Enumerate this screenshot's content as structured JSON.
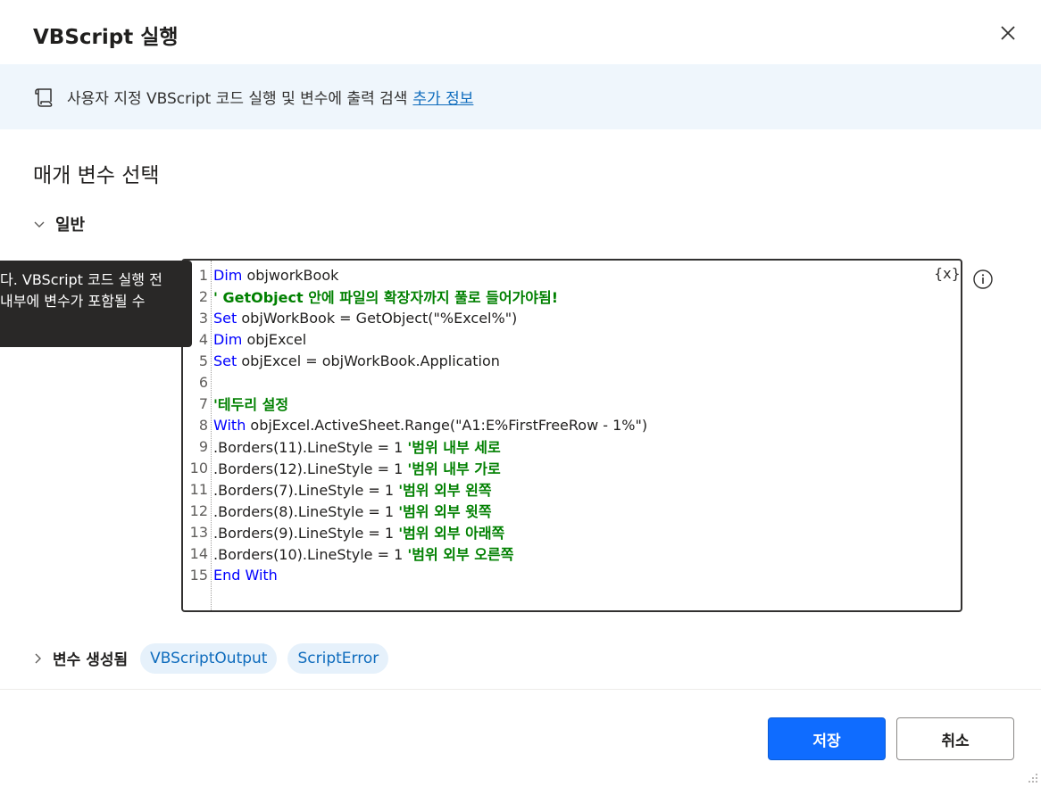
{
  "dialog": {
    "title": "VBScript 실행",
    "close_icon": "close-icon"
  },
  "info": {
    "icon": "script-icon",
    "description": "사용자 지정 VBScript 코드 실행 및 변수에 출력 검색",
    "link_label": "추가 정보"
  },
  "section": {
    "title": "매개 변수 선택",
    "group_label": "일반"
  },
  "tooltip": {
    "line1": "다. VBScript 코드 실행 전",
    "line2": " 내부에 변수가 포함될 수"
  },
  "editor": {
    "var_button_label": "{x}",
    "lines": [
      {
        "num": "1",
        "parts": [
          {
            "t": "Dim",
            "c": "kw"
          },
          {
            "t": " objworkBook",
            "c": "pl"
          }
        ]
      },
      {
        "num": "2",
        "parts": [
          {
            "t": "' GetObject 안에 파일의 확장자까지 풀로 들어가야됨!",
            "c": "cm"
          }
        ]
      },
      {
        "num": "3",
        "parts": [
          {
            "t": "Set",
            "c": "kw"
          },
          {
            "t": " objWorkBook = GetObject(\"%Excel%\")",
            "c": "pl"
          }
        ]
      },
      {
        "num": "4",
        "parts": [
          {
            "t": "Dim",
            "c": "kw"
          },
          {
            "t": " objExcel",
            "c": "pl"
          }
        ]
      },
      {
        "num": "5",
        "parts": [
          {
            "t": "Set",
            "c": "kw"
          },
          {
            "t": " objExcel = objWorkBook.Application",
            "c": "pl"
          }
        ]
      },
      {
        "num": "6",
        "parts": []
      },
      {
        "num": "7",
        "parts": [
          {
            "t": "'테두리 설정",
            "c": "cm"
          }
        ]
      },
      {
        "num": "8",
        "parts": [
          {
            "t": "With",
            "c": "kw"
          },
          {
            "t": " objExcel.ActiveSheet.Range(\"A1:E%FirstFreeRow - 1%\")",
            "c": "pl"
          }
        ]
      },
      {
        "num": "9",
        "parts": [
          {
            "t": ".Borders(11).LineStyle = 1 ",
            "c": "pl"
          },
          {
            "t": "'범위 내부 세로",
            "c": "cm"
          }
        ]
      },
      {
        "num": "10",
        "parts": [
          {
            "t": ".Borders(12).LineStyle = 1 ",
            "c": "pl"
          },
          {
            "t": "'범위 내부 가로",
            "c": "cm"
          }
        ]
      },
      {
        "num": "11",
        "parts": [
          {
            "t": ".Borders(7).LineStyle = 1 ",
            "c": "pl"
          },
          {
            "t": "'범위 외부 왼쪽",
            "c": "cm"
          }
        ]
      },
      {
        "num": "12",
        "parts": [
          {
            "t": ".Borders(8).LineStyle = 1 ",
            "c": "pl"
          },
          {
            "t": "'범위 외부 윗쪽",
            "c": "cm"
          }
        ]
      },
      {
        "num": "13",
        "parts": [
          {
            "t": ".Borders(9).LineStyle = 1 ",
            "c": "pl"
          },
          {
            "t": "'범위 외부 아래쪽",
            "c": "cm"
          }
        ]
      },
      {
        "num": "14",
        "parts": [
          {
            "t": ".Borders(10).LineStyle = 1 ",
            "c": "pl"
          },
          {
            "t": "'범위 외부 오른쪽",
            "c": "cm"
          }
        ]
      },
      {
        "num": "15",
        "parts": [
          {
            "t": "End With",
            "c": "kw"
          }
        ]
      }
    ]
  },
  "variables": {
    "label": "변수 생성됨",
    "items": [
      "VBScriptOutput",
      "ScriptError"
    ]
  },
  "footer": {
    "save_label": "저장",
    "cancel_label": "취소"
  },
  "colors": {
    "primary": "#0f6cff",
    "keyword": "#0000ff",
    "comment": "#008000",
    "banner_bg": "#eff6fc",
    "link": "#0f6cbd"
  }
}
